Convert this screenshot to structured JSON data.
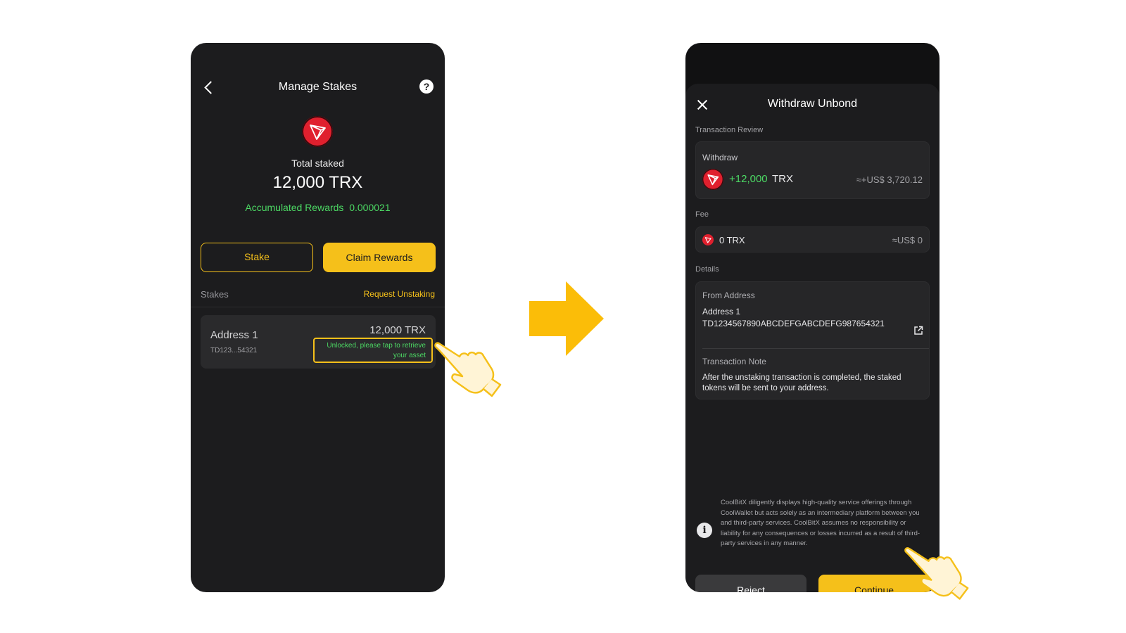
{
  "left_screen": {
    "title": "Manage Stakes",
    "total_label": "Total staked",
    "total_amount": "12,000 TRX",
    "rewards_label": "Accumulated Rewards",
    "rewards_value": "0.000021",
    "stake_button": "Stake",
    "claim_button": "Claim Rewards",
    "stakes_label": "Stakes",
    "request_unstaking": "Request Unstaking",
    "stake_item": {
      "name": "Address 1",
      "address": "TD123...54321",
      "amount": "12,000 TRX",
      "status": "Unlocked, please tap to retrieve your asset"
    }
  },
  "right_screen": {
    "title": "Withdraw Unbond",
    "transaction_review_label": "Transaction Review",
    "withdraw": {
      "label": "Withdraw",
      "amount": "+12,000",
      "unit": "TRX",
      "usd": "≈+US$ 3,720.12"
    },
    "fee_label": "Fee",
    "fee": {
      "amount": "0 TRX",
      "usd": "≈US$ 0"
    },
    "details_label": "Details",
    "details": {
      "from_label": "From Address",
      "name": "Address 1",
      "address": "TD1234567890ABCDEFGABCDEFG987654321",
      "note_label": "Transaction Note",
      "note": "After the unstaking transaction is completed, the staked tokens will be sent to your address."
    },
    "disclaimer": "CoolBitX diligently displays high-quality service offerings through CoolWallet but acts solely as an intermediary platform between you and third-party services. CoolBitX assumes no responsibility or liability for any consequences or losses incurred as a result of third-party services in any manner.",
    "reject_button": "Reject",
    "continue_button": "Continue"
  },
  "colors": {
    "accent": "#f5c01a",
    "positive": "#4cd964",
    "tron_red": "#e0202e",
    "panel": "#1c1c1e"
  }
}
